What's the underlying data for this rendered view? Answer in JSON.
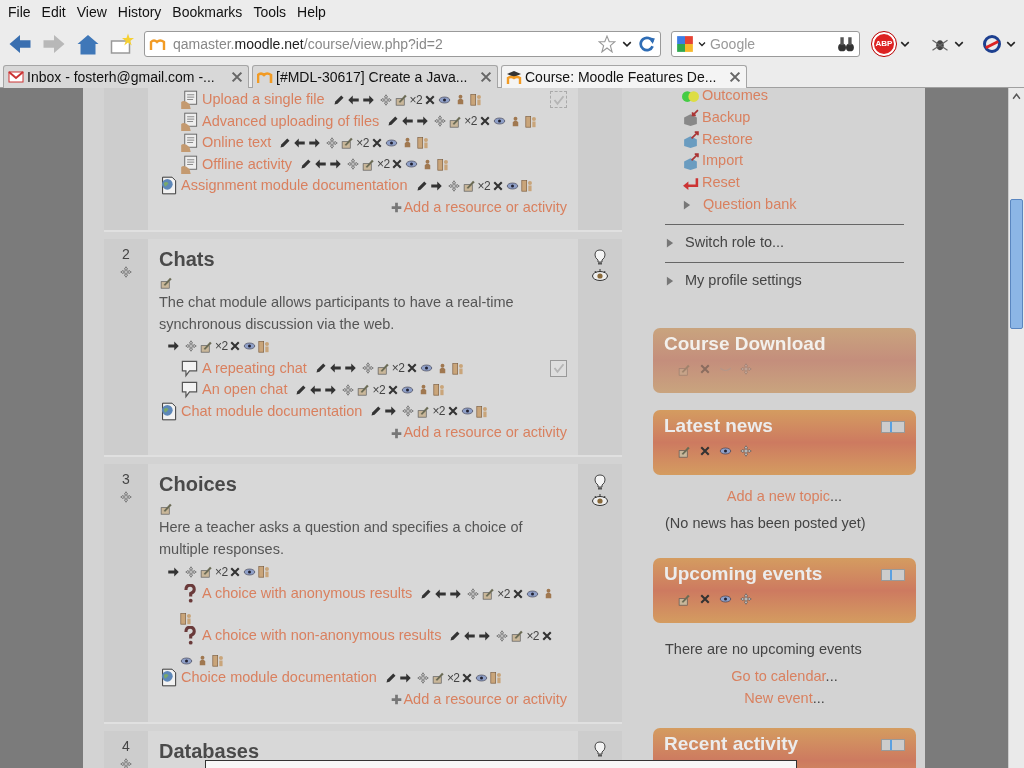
{
  "menu": [
    "File",
    "Edit",
    "View",
    "History",
    "Bookmarks",
    "Tools",
    "Help"
  ],
  "navigation": {
    "back_enabled": true,
    "forward_enabled": false,
    "url_prefix": "qamaster.",
    "url_domain": "moodle.net",
    "url_path": "/course/view.php?id=2",
    "search_placeholder": "Google",
    "adblock_label": "ABP"
  },
  "tabs": [
    {
      "title": "Inbox - fosterh@gmail.com -...",
      "kind": "mail",
      "selected": false
    },
    {
      "title": "[#MDL-30617] Create a Java...",
      "kind": "moodle",
      "selected": false
    },
    {
      "title": "Course: Moodle Features De...",
      "kind": "moodle-cap",
      "selected": true
    }
  ],
  "sections": [
    {
      "items": [
        {
          "kind": "assignment",
          "title": "Upload a single file",
          "indented": true,
          "tools": [
            {
              "kind": "edit"
            },
            {
              "kind": "left"
            },
            {
              "kind": "right"
            },
            {
              "kind": "move"
            },
            {
              "kind": "update"
            },
            {
              "kind": "duplicate",
              "label": "×2"
            },
            {
              "kind": "delete"
            },
            {
              "kind": "hide"
            },
            {
              "kind": "role"
            },
            {
              "kind": "groups"
            }
          ],
          "completion_tracked": true,
          "completion_manual": false,
          "completed": false
        },
        {
          "kind": "assignment",
          "title": "Advanced uploading of files",
          "indented": true,
          "tools": [
            {
              "kind": "edit"
            },
            {
              "kind": "left"
            },
            {
              "kind": "right"
            },
            {
              "kind": "move"
            },
            {
              "kind": "update"
            },
            {
              "kind": "duplicate",
              "label": "×2"
            },
            {
              "kind": "delete"
            },
            {
              "kind": "hide"
            },
            {
              "kind": "role"
            },
            {
              "kind": "groups"
            }
          ],
          "completion_tracked": false
        },
        {
          "kind": "assignment",
          "title": "Online text",
          "indented": true,
          "tools": [
            {
              "kind": "edit"
            },
            {
              "kind": "left"
            },
            {
              "kind": "right"
            },
            {
              "kind": "move"
            },
            {
              "kind": "update"
            },
            {
              "kind": "duplicate",
              "label": "×2"
            },
            {
              "kind": "delete"
            },
            {
              "kind": "hide"
            },
            {
              "kind": "role"
            },
            {
              "kind": "groups"
            }
          ],
          "completion_tracked": false
        },
        {
          "kind": "assignment",
          "title": "Offline activity",
          "indented": true,
          "tools": [
            {
              "kind": "edit"
            },
            {
              "kind": "left"
            },
            {
              "kind": "right"
            },
            {
              "kind": "move"
            },
            {
              "kind": "update"
            },
            {
              "kind": "duplicate",
              "label": "×2"
            },
            {
              "kind": "delete"
            },
            {
              "kind": "hide"
            },
            {
              "kind": "role"
            },
            {
              "kind": "groups"
            }
          ],
          "completion_tracked": false
        },
        {
          "kind": "doc",
          "title": "Assignment module documentation",
          "indented": false,
          "tools": [
            {
              "kind": "edit"
            },
            {
              "kind": "right"
            },
            {
              "kind": "move"
            },
            {
              "kind": "update"
            },
            {
              "kind": "duplicate",
              "label": "×2"
            },
            {
              "kind": "delete"
            },
            {
              "kind": "hide"
            },
            {
              "kind": "groups"
            }
          ],
          "completion_tracked": false
        }
      ],
      "add_label": "Add a resource or activity"
    },
    {
      "number": "2",
      "title": "Chats",
      "summary": "The chat module allows participants to have a real-time synchronous discussion via the web.",
      "summary_tools": [
        {
          "kind": "right"
        },
        {
          "kind": "move"
        },
        {
          "kind": "update"
        },
        {
          "kind": "duplicate",
          "label": "×2"
        },
        {
          "kind": "delete"
        },
        {
          "kind": "hide"
        },
        {
          "kind": "groups"
        }
      ],
      "highlighted": false,
      "visible": true,
      "items": [
        {
          "kind": "chat",
          "title": "A repeating chat",
          "indented": true,
          "tools": [
            {
              "kind": "edit"
            },
            {
              "kind": "left"
            },
            {
              "kind": "right"
            },
            {
              "kind": "move"
            },
            {
              "kind": "update"
            },
            {
              "kind": "duplicate",
              "label": "×2"
            },
            {
              "kind": "delete"
            },
            {
              "kind": "hide"
            },
            {
              "kind": "role"
            },
            {
              "kind": "groups"
            }
          ],
          "completion_tracked": true,
          "completion_manual": true,
          "completed": false
        },
        {
          "kind": "chat",
          "title": "An open chat",
          "indented": true,
          "tools": [
            {
              "kind": "edit"
            },
            {
              "kind": "left"
            },
            {
              "kind": "right"
            },
            {
              "kind": "move"
            },
            {
              "kind": "update"
            },
            {
              "kind": "duplicate",
              "label": "×2"
            },
            {
              "kind": "delete"
            },
            {
              "kind": "hide"
            },
            {
              "kind": "role"
            },
            {
              "kind": "groups"
            }
          ],
          "completion_tracked": false
        },
        {
          "kind": "doc",
          "title": "Chat module documentation",
          "indented": false,
          "tools": [
            {
              "kind": "edit"
            },
            {
              "kind": "right"
            },
            {
              "kind": "move"
            },
            {
              "kind": "update"
            },
            {
              "kind": "duplicate",
              "label": "×2"
            },
            {
              "kind": "delete"
            },
            {
              "kind": "hide"
            },
            {
              "kind": "groups"
            }
          ],
          "completion_tracked": false
        }
      ],
      "add_label": "Add a resource or activity"
    },
    {
      "number": "3",
      "title": "Choices",
      "summary": "Here a teacher asks a question and specifies a choice of multiple responses.",
      "summary_tools": [
        {
          "kind": "right"
        },
        {
          "kind": "move"
        },
        {
          "kind": "update"
        },
        {
          "kind": "duplicate",
          "label": "×2"
        },
        {
          "kind": "delete"
        },
        {
          "kind": "hide"
        },
        {
          "kind": "groups"
        }
      ],
      "highlighted": false,
      "visible": true,
      "items": [
        {
          "kind": "choice",
          "title": "A choice with anonymous results",
          "indented": true,
          "tools": [
            {
              "kind": "edit"
            },
            {
              "kind": "left"
            },
            {
              "kind": "right"
            },
            {
              "kind": "move"
            },
            {
              "kind": "update"
            },
            {
              "kind": "duplicate",
              "label": "×2"
            },
            {
              "kind": "delete"
            },
            {
              "kind": "hide"
            },
            {
              "kind": "role"
            },
            {
              "kind": "groups"
            }
          ],
          "completion_tracked": false
        },
        {
          "kind": "choice",
          "title": "A choice with non-anonymous results",
          "indented": true,
          "tools": [
            {
              "kind": "edit"
            },
            {
              "kind": "left"
            },
            {
              "kind": "right"
            },
            {
              "kind": "move"
            },
            {
              "kind": "update"
            },
            {
              "kind": "duplicate",
              "label": "×2"
            },
            {
              "kind": "delete"
            },
            {
              "kind": "hide"
            },
            {
              "kind": "role"
            },
            {
              "kind": "groups"
            }
          ],
          "completion_tracked": false
        },
        {
          "kind": "doc",
          "title": "Choice module documentation",
          "indented": false,
          "tools": [
            {
              "kind": "edit"
            },
            {
              "kind": "right"
            },
            {
              "kind": "move"
            },
            {
              "kind": "update"
            },
            {
              "kind": "duplicate",
              "label": "×2"
            },
            {
              "kind": "delete"
            },
            {
              "kind": "hide"
            },
            {
              "kind": "groups"
            }
          ],
          "completion_tracked": false
        }
      ],
      "add_label": "Add a resource or activity"
    },
    {
      "number": "4",
      "title": "Databases",
      "highlighted": false
    }
  ],
  "settings_nav": {
    "items": [
      {
        "kind": "outcomes",
        "label": "Outcomes"
      },
      {
        "kind": "backup",
        "label": "Backup"
      },
      {
        "kind": "restore",
        "label": "Restore"
      },
      {
        "kind": "import",
        "label": "Import"
      },
      {
        "kind": "reset",
        "label": "Reset"
      },
      {
        "kind": "branch",
        "label": "Question bank",
        "expanded": false
      }
    ],
    "branches": [
      {
        "label": "Switch role to...",
        "expanded": false
      },
      {
        "label": "My profile settings",
        "expanded": false
      }
    ]
  },
  "blocks": [
    {
      "title": "Course Download",
      "hidden": true,
      "collapsible": false,
      "controls": [
        {
          "kind": "update"
        },
        {
          "kind": "delete"
        },
        {
          "kind": "hide"
        },
        {
          "kind": "move"
        }
      ]
    },
    {
      "title": "Latest news",
      "hidden": false,
      "collapsible": true,
      "controls": [
        {
          "kind": "update"
        },
        {
          "kind": "delete"
        },
        {
          "kind": "hide"
        },
        {
          "kind": "move"
        }
      ],
      "body": [
        {
          "kind": "link",
          "text": "Add a new topic",
          "suffix": "..."
        },
        {
          "kind": "text",
          "text": "(No news has been posted yet)"
        }
      ]
    },
    {
      "title": "Upcoming events",
      "hidden": false,
      "collapsible": true,
      "controls": [
        {
          "kind": "update"
        },
        {
          "kind": "delete"
        },
        {
          "kind": "hide"
        },
        {
          "kind": "move"
        }
      ],
      "body": [
        {
          "kind": "text",
          "text": "There are no upcoming events"
        },
        {
          "kind": "link",
          "text": "Go to calendar",
          "suffix": "..."
        },
        {
          "kind": "link",
          "text": "New event",
          "suffix": "..."
        }
      ]
    },
    {
      "title": "Recent activity",
      "hidden": false,
      "collapsible": true
    }
  ]
}
